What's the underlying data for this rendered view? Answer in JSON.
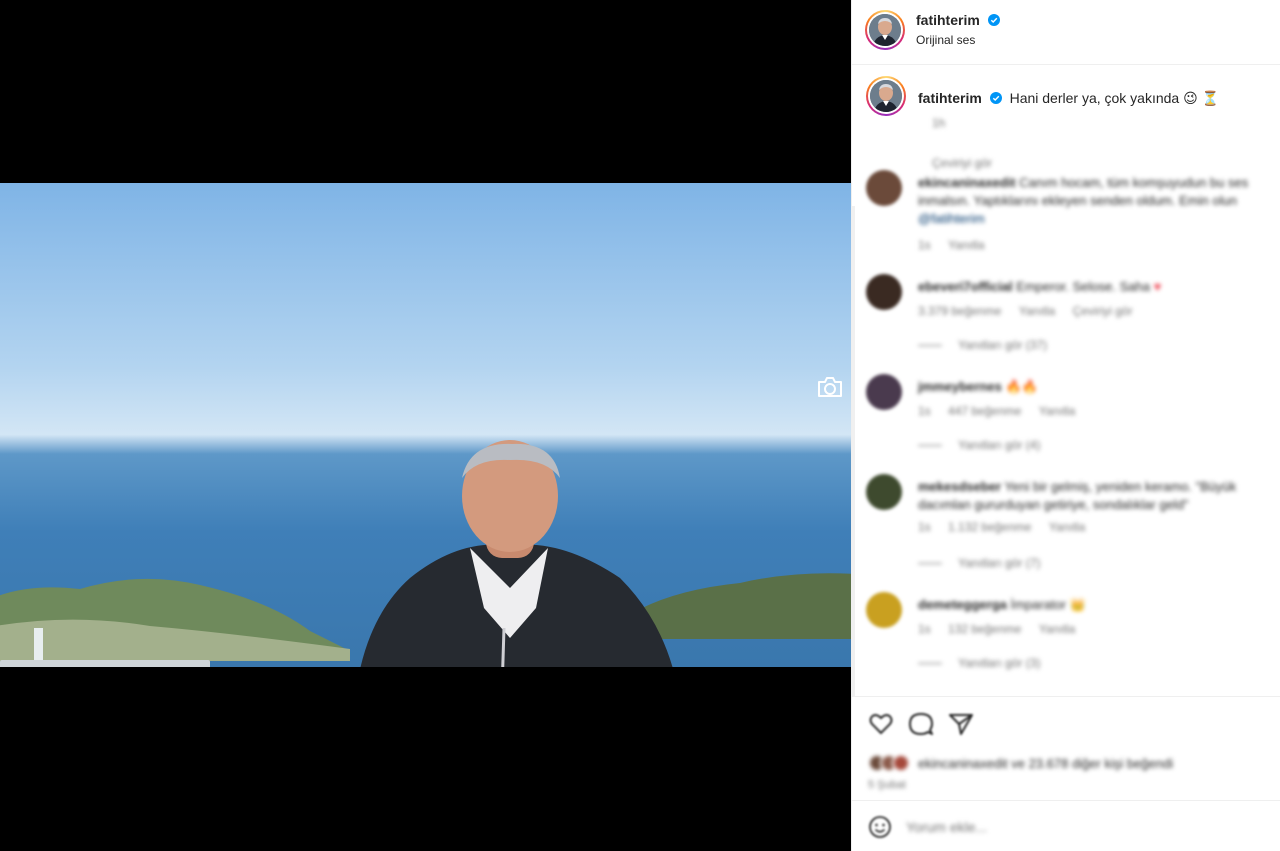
{
  "header": {
    "username": "fatihterim",
    "audio": "Orijinal ses"
  },
  "caption": {
    "username": "fatihterim",
    "text": "Hani derler ya, çok yakında 😉 ⏳",
    "time": "1h",
    "see_translation": "Çeviriyi gör"
  },
  "comments": [
    {
      "username": "ekincaninaxedit",
      "text": "Canım hocam, tüm komşuyudun bu ses inmalsın. Yaptıklarını ekleyen senden oldum. Emin olun",
      "link": "@fatihterim",
      "meta": [
        "1s",
        "Yanıtla"
      ],
      "replies": "",
      "avatar_color": "#6b4a3a"
    },
    {
      "username": "ebeveri7official",
      "text": "Emperor. Selose. Saha",
      "link": "",
      "meta": [
        "3.379 beğenme",
        "Yanıtla",
        "Çeviriyi gör"
      ],
      "replies": "Yanıtları gör (37)",
      "avatar_color": "#3a2a22"
    },
    {
      "username": "jmmeybernes",
      "text": "🔥🔥",
      "link": "",
      "meta": [
        "1s",
        "447 beğenme",
        "Yanıtla"
      ],
      "replies": "Yanıtları gör (4)",
      "avatar_color": "#4a3a4e"
    },
    {
      "username": "mekesdseber",
      "text": "Yeni bir gelmiş, yeniden keramo. \"Büyük dacımlan gururduyan getiriye, sondalıklar geld\"",
      "link": "",
      "meta": [
        "1s",
        "1.132 beğenme",
        "Yanıtla"
      ],
      "replies": "Yanıtları gör (7)",
      "avatar_color": "#3e4a2e"
    },
    {
      "username": "demeteggerga",
      "text": "İmparator 👑",
      "link": "",
      "meta": [
        "1s",
        "132 beğenme",
        "Yanıtla"
      ],
      "replies": "Yanıtları gör (3)",
      "avatar_color": "#c9a020"
    }
  ],
  "likes": {
    "text": "ekincaninaxedit ve 23.678 diğer kişi beğendi",
    "date": "5 Şubat"
  },
  "comment_input": {
    "placeholder": "Yorum ekle..."
  }
}
